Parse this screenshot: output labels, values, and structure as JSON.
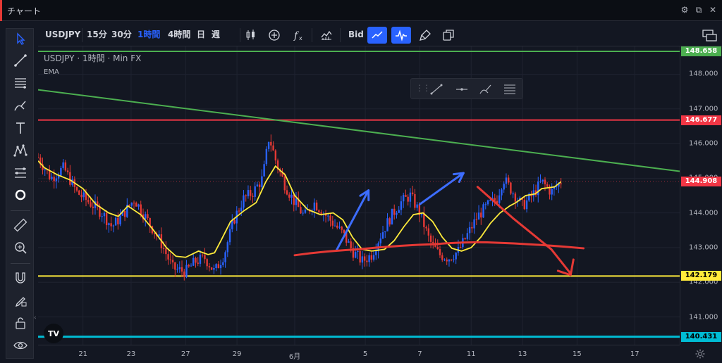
{
  "window": {
    "title": "チャート"
  },
  "toolbar": {
    "symbol": "USDJPY",
    "intervals": [
      {
        "label": "15分",
        "active": false
      },
      {
        "label": "30分",
        "active": false
      },
      {
        "label": "1時間",
        "active": true
      },
      {
        "label": "4時間",
        "active": false
      },
      {
        "label": "日",
        "active": false
      },
      {
        "label": "週",
        "active": false
      }
    ],
    "bid_label": "Bid"
  },
  "legend": {
    "symbol": "USDJPY",
    "sep1": "·",
    "interval": "1時間",
    "sep2": "·",
    "source": "Min FX",
    "indicator": "EMA"
  },
  "price_scale": {
    "ticks": [
      "148.000",
      "147.000",
      "146.000",
      "145.000",
      "144.000",
      "143.000",
      "142.000",
      "141.000"
    ],
    "labels": [
      {
        "value": "148.658",
        "color": "#4caf50",
        "text_color": "#ffffff"
      },
      {
        "value": "146.677",
        "color": "#f23645",
        "text_color": "#ffffff"
      },
      {
        "value": "144.908",
        "color": "#f23645",
        "text_color": "#ffffff"
      },
      {
        "value": "142.179",
        "color": "#ffeb3b",
        "text_color": "#000000"
      },
      {
        "value": "140.431",
        "color": "#00bcd4",
        "text_color": "#000000"
      }
    ]
  },
  "time_scale": {
    "ticks": [
      "21",
      "23",
      "27",
      "29",
      "6月",
      "5",
      "7",
      "11",
      "13",
      "15",
      "17"
    ]
  },
  "logo_text": "TV",
  "colors": {
    "background": "#131722",
    "grid": "#1f2330",
    "up": "#2962ff",
    "down": "#e53935",
    "ema": "#ffeb3b",
    "blue_arrow": "#3d6dff",
    "red_drawing": "#e53935",
    "active_blue": "#2962ff"
  },
  "chart_data": {
    "type": "candlestick",
    "symbol": "USDJPY",
    "interval": "1時間",
    "ylim": [
      140.2,
      148.8
    ],
    "x_ticks": [
      "21",
      "23",
      "27",
      "29",
      "6月",
      "5",
      "7",
      "11",
      "13",
      "15",
      "17"
    ],
    "horizontal_lines": [
      {
        "price": 148.658,
        "color": "#4caf50"
      },
      {
        "price": 146.677,
        "color": "#f23645"
      },
      {
        "price": 142.179,
        "color": "#ffeb3b"
      },
      {
        "price": 140.431,
        "color": "#00bcd4"
      }
    ],
    "trendline": {
      "from_price": 147.55,
      "to_price": 145.2,
      "color": "#4caf50"
    },
    "last_price": 144.908,
    "ema_path": [
      [
        0.0,
        145.5
      ],
      [
        0.01,
        145.3
      ],
      [
        0.03,
        145.1
      ],
      [
        0.05,
        144.95
      ],
      [
        0.07,
        144.7
      ],
      [
        0.09,
        144.25
      ],
      [
        0.11,
        144.0
      ],
      [
        0.125,
        143.9
      ],
      [
        0.14,
        144.2
      ],
      [
        0.16,
        143.95
      ],
      [
        0.18,
        143.5
      ],
      [
        0.2,
        143.0
      ],
      [
        0.215,
        142.75
      ],
      [
        0.23,
        142.72
      ],
      [
        0.25,
        142.9
      ],
      [
        0.265,
        142.8
      ],
      [
        0.275,
        142.85
      ],
      [
        0.285,
        143.2
      ],
      [
        0.3,
        143.75
      ],
      [
        0.32,
        144.05
      ],
      [
        0.34,
        144.3
      ],
      [
        0.355,
        144.9
      ],
      [
        0.37,
        145.35
      ],
      [
        0.385,
        145.1
      ],
      [
        0.4,
        144.5
      ],
      [
        0.42,
        144.1
      ],
      [
        0.44,
        143.95
      ],
      [
        0.46,
        144.0
      ],
      [
        0.475,
        143.8
      ],
      [
        0.49,
        143.3
      ],
      [
        0.505,
        142.95
      ],
      [
        0.52,
        142.9
      ],
      [
        0.54,
        142.95
      ],
      [
        0.555,
        143.2
      ],
      [
        0.57,
        143.6
      ],
      [
        0.585,
        143.95
      ],
      [
        0.6,
        144.0
      ],
      [
        0.615,
        143.75
      ],
      [
        0.63,
        143.3
      ],
      [
        0.645,
        142.98
      ],
      [
        0.66,
        142.9
      ],
      [
        0.675,
        143.0
      ],
      [
        0.69,
        143.3
      ],
      [
        0.705,
        143.7
      ],
      [
        0.72,
        144.0
      ],
      [
        0.735,
        144.2
      ],
      [
        0.745,
        144.3
      ],
      [
        0.76,
        144.5
      ],
      [
        0.775,
        144.55
      ],
      [
        0.785,
        144.7
      ],
      [
        0.805,
        144.75
      ],
      [
        0.815,
        144.9
      ]
    ],
    "candle_path": [
      [
        0.0,
        145.6
      ],
      [
        0.02,
        145.0
      ],
      [
        0.04,
        145.3
      ],
      [
        0.06,
        144.6
      ],
      [
        0.08,
        144.3
      ],
      [
        0.1,
        144.0
      ],
      [
        0.115,
        143.6
      ],
      [
        0.13,
        143.9
      ],
      [
        0.15,
        144.4
      ],
      [
        0.17,
        143.8
      ],
      [
        0.19,
        143.2
      ],
      [
        0.21,
        142.4
      ],
      [
        0.23,
        142.3
      ],
      [
        0.245,
        142.6
      ],
      [
        0.26,
        142.7
      ],
      [
        0.275,
        142.3
      ],
      [
        0.29,
        142.8
      ],
      [
        0.305,
        143.8
      ],
      [
        0.32,
        144.4
      ],
      [
        0.335,
        144.6
      ],
      [
        0.35,
        145.0
      ],
      [
        0.36,
        146.2
      ],
      [
        0.372,
        145.4
      ],
      [
        0.385,
        144.8
      ],
      [
        0.4,
        144.3
      ],
      [
        0.415,
        143.9
      ],
      [
        0.43,
        144.3
      ],
      [
        0.445,
        144.0
      ],
      [
        0.46,
        143.7
      ],
      [
        0.475,
        143.4
      ],
      [
        0.49,
        142.9
      ],
      [
        0.505,
        142.6
      ],
      [
        0.52,
        142.8
      ],
      [
        0.535,
        143.4
      ],
      [
        0.55,
        143.9
      ],
      [
        0.565,
        144.3
      ],
      [
        0.58,
        144.5
      ],
      [
        0.595,
        144.0
      ],
      [
        0.61,
        143.2
      ],
      [
        0.625,
        142.8
      ],
      [
        0.64,
        142.7
      ],
      [
        0.655,
        142.9
      ],
      [
        0.67,
        143.4
      ],
      [
        0.685,
        143.9
      ],
      [
        0.7,
        144.2
      ],
      [
        0.715,
        144.4
      ],
      [
        0.725,
        145.0
      ],
      [
        0.74,
        144.6
      ],
      [
        0.755,
        144.2
      ],
      [
        0.77,
        144.5
      ],
      [
        0.785,
        144.9
      ],
      [
        0.8,
        144.6
      ],
      [
        0.815,
        144.9
      ]
    ],
    "annotations": {
      "blue_arrows": [
        {
          "from": [
            0.465,
            142.92
          ],
          "to": [
            0.515,
            144.65
          ]
        },
        {
          "from": [
            0.595,
            144.25
          ],
          "to": [
            0.663,
            145.15
          ]
        }
      ],
      "red_curve": [
        [
          0.4,
          142.78
        ],
        [
          0.5,
          142.95
        ],
        [
          0.62,
          143.1
        ],
        [
          0.7,
          143.15
        ],
        [
          0.85,
          142.98
        ]
      ],
      "red_arrow": [
        [
          0.685,
          144.75
        ],
        [
          0.74,
          143.85
        ],
        [
          0.8,
          142.95
        ],
        [
          0.83,
          142.25
        ]
      ]
    }
  }
}
